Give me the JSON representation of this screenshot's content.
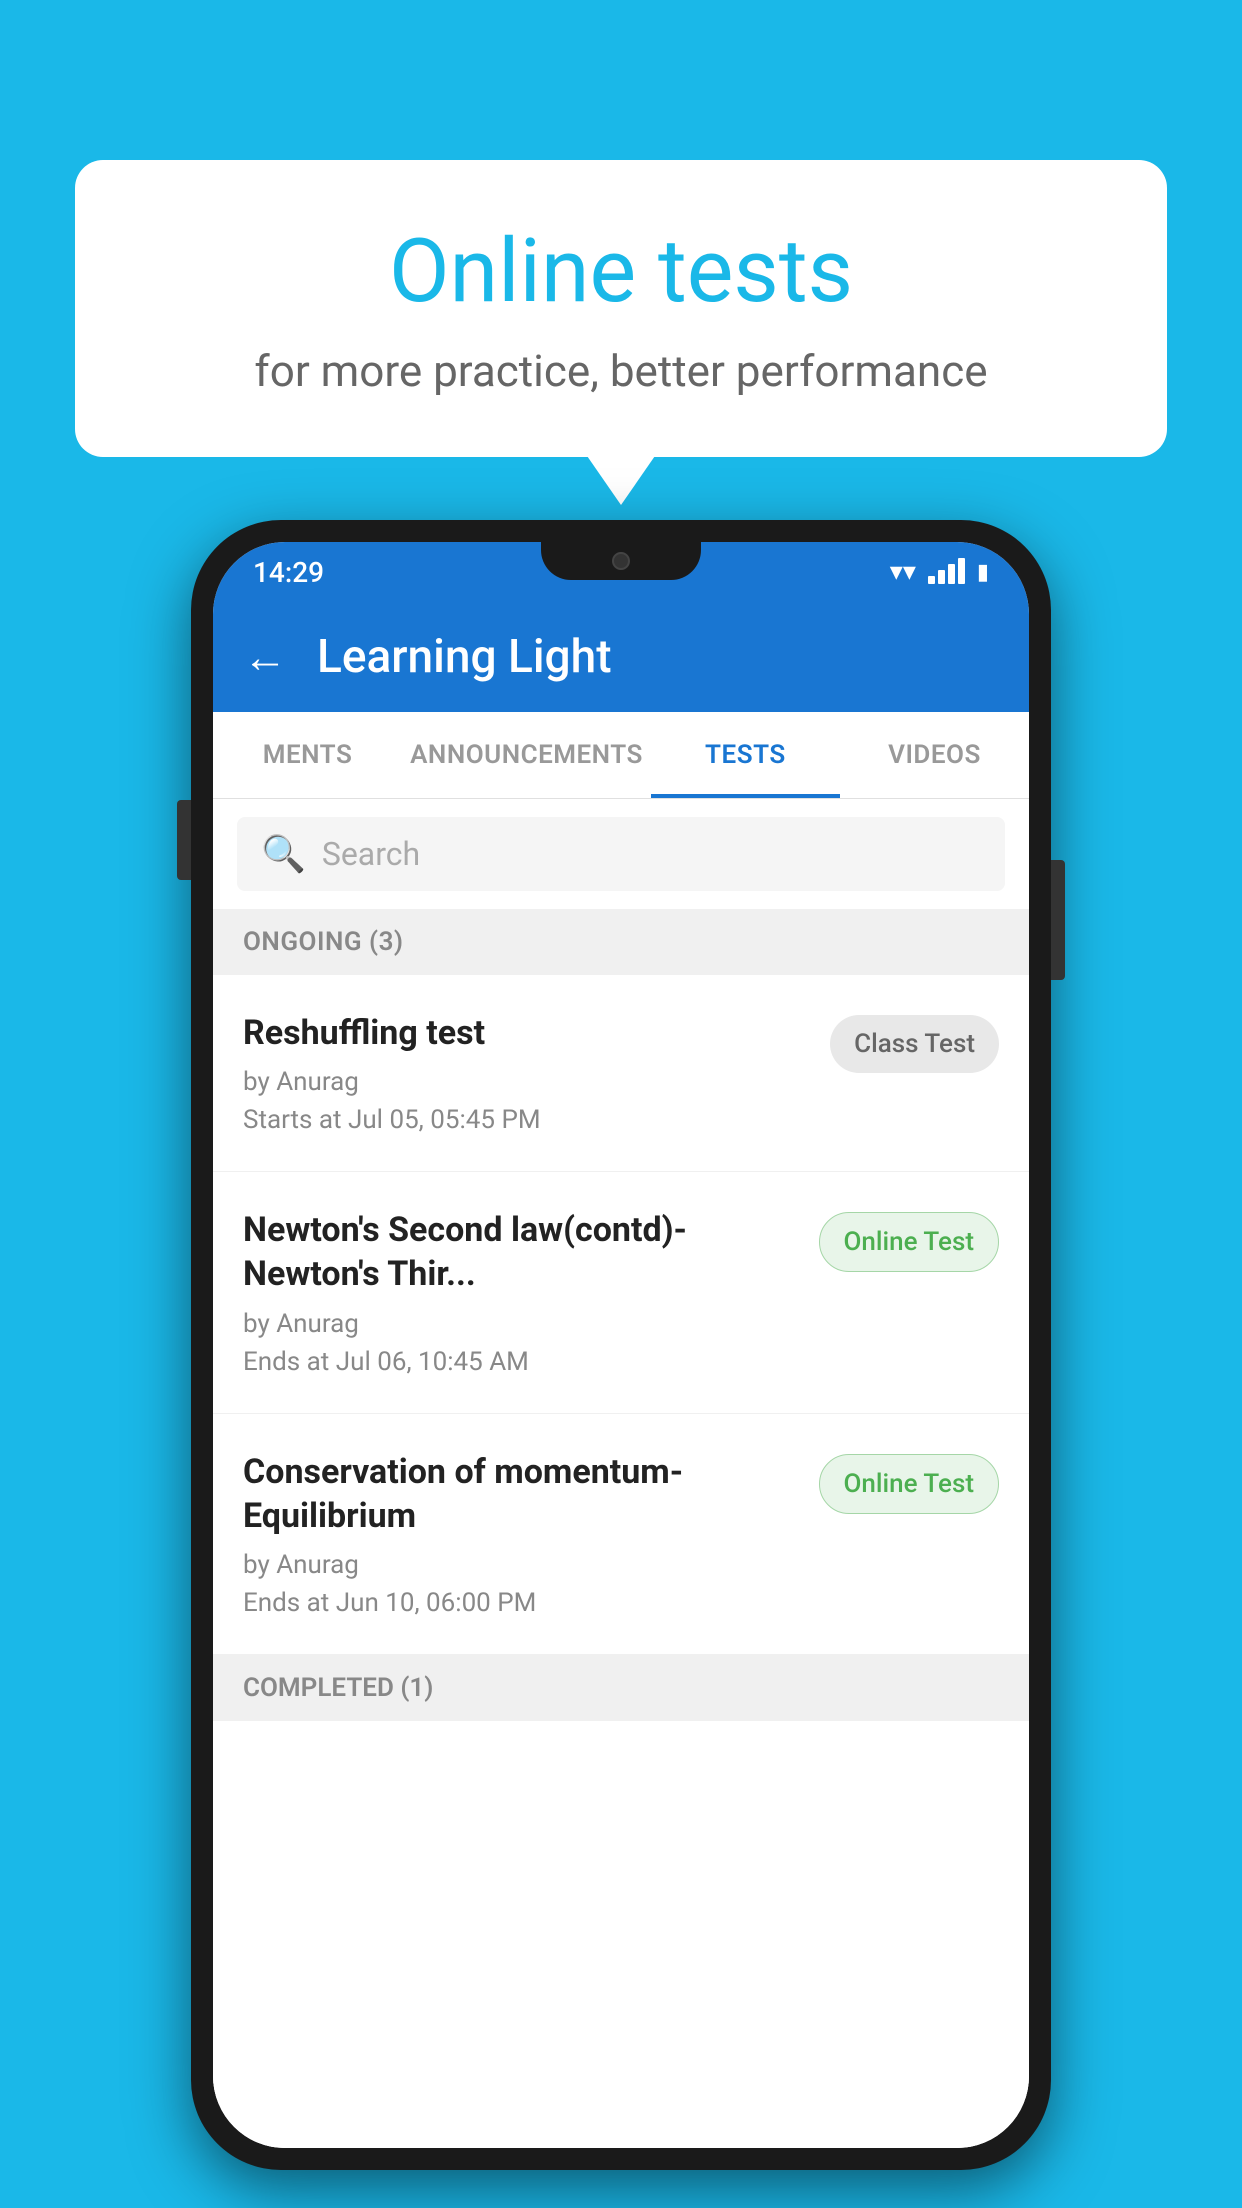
{
  "background_color": "#1ab8e8",
  "speech_bubble": {
    "title": "Online tests",
    "subtitle": "for more practice, better performance"
  },
  "phone": {
    "status_bar": {
      "time": "14:29"
    },
    "app_bar": {
      "title": "Learning Light",
      "back_label": "←"
    },
    "tabs": [
      {
        "label": "MENTS",
        "active": false
      },
      {
        "label": "ANNOUNCEMENTS",
        "active": false
      },
      {
        "label": "TESTS",
        "active": true
      },
      {
        "label": "VIDEOS",
        "active": false
      }
    ],
    "search": {
      "placeholder": "Search"
    },
    "ongoing_section": {
      "title": "ONGOING (3)"
    },
    "tests": [
      {
        "name": "Reshuffling test",
        "by": "by Anurag",
        "time": "Starts at  Jul 05, 05:45 PM",
        "badge": "Class Test",
        "badge_type": "class"
      },
      {
        "name": "Newton's Second law(contd)-Newton's Thir...",
        "by": "by Anurag",
        "time": "Ends at  Jul 06, 10:45 AM",
        "badge": "Online Test",
        "badge_type": "online"
      },
      {
        "name": "Conservation of momentum-Equilibrium",
        "by": "by Anurag",
        "time": "Ends at  Jun 10, 06:00 PM",
        "badge": "Online Test",
        "badge_type": "online"
      }
    ],
    "completed_section": {
      "title": "COMPLETED (1)"
    }
  }
}
